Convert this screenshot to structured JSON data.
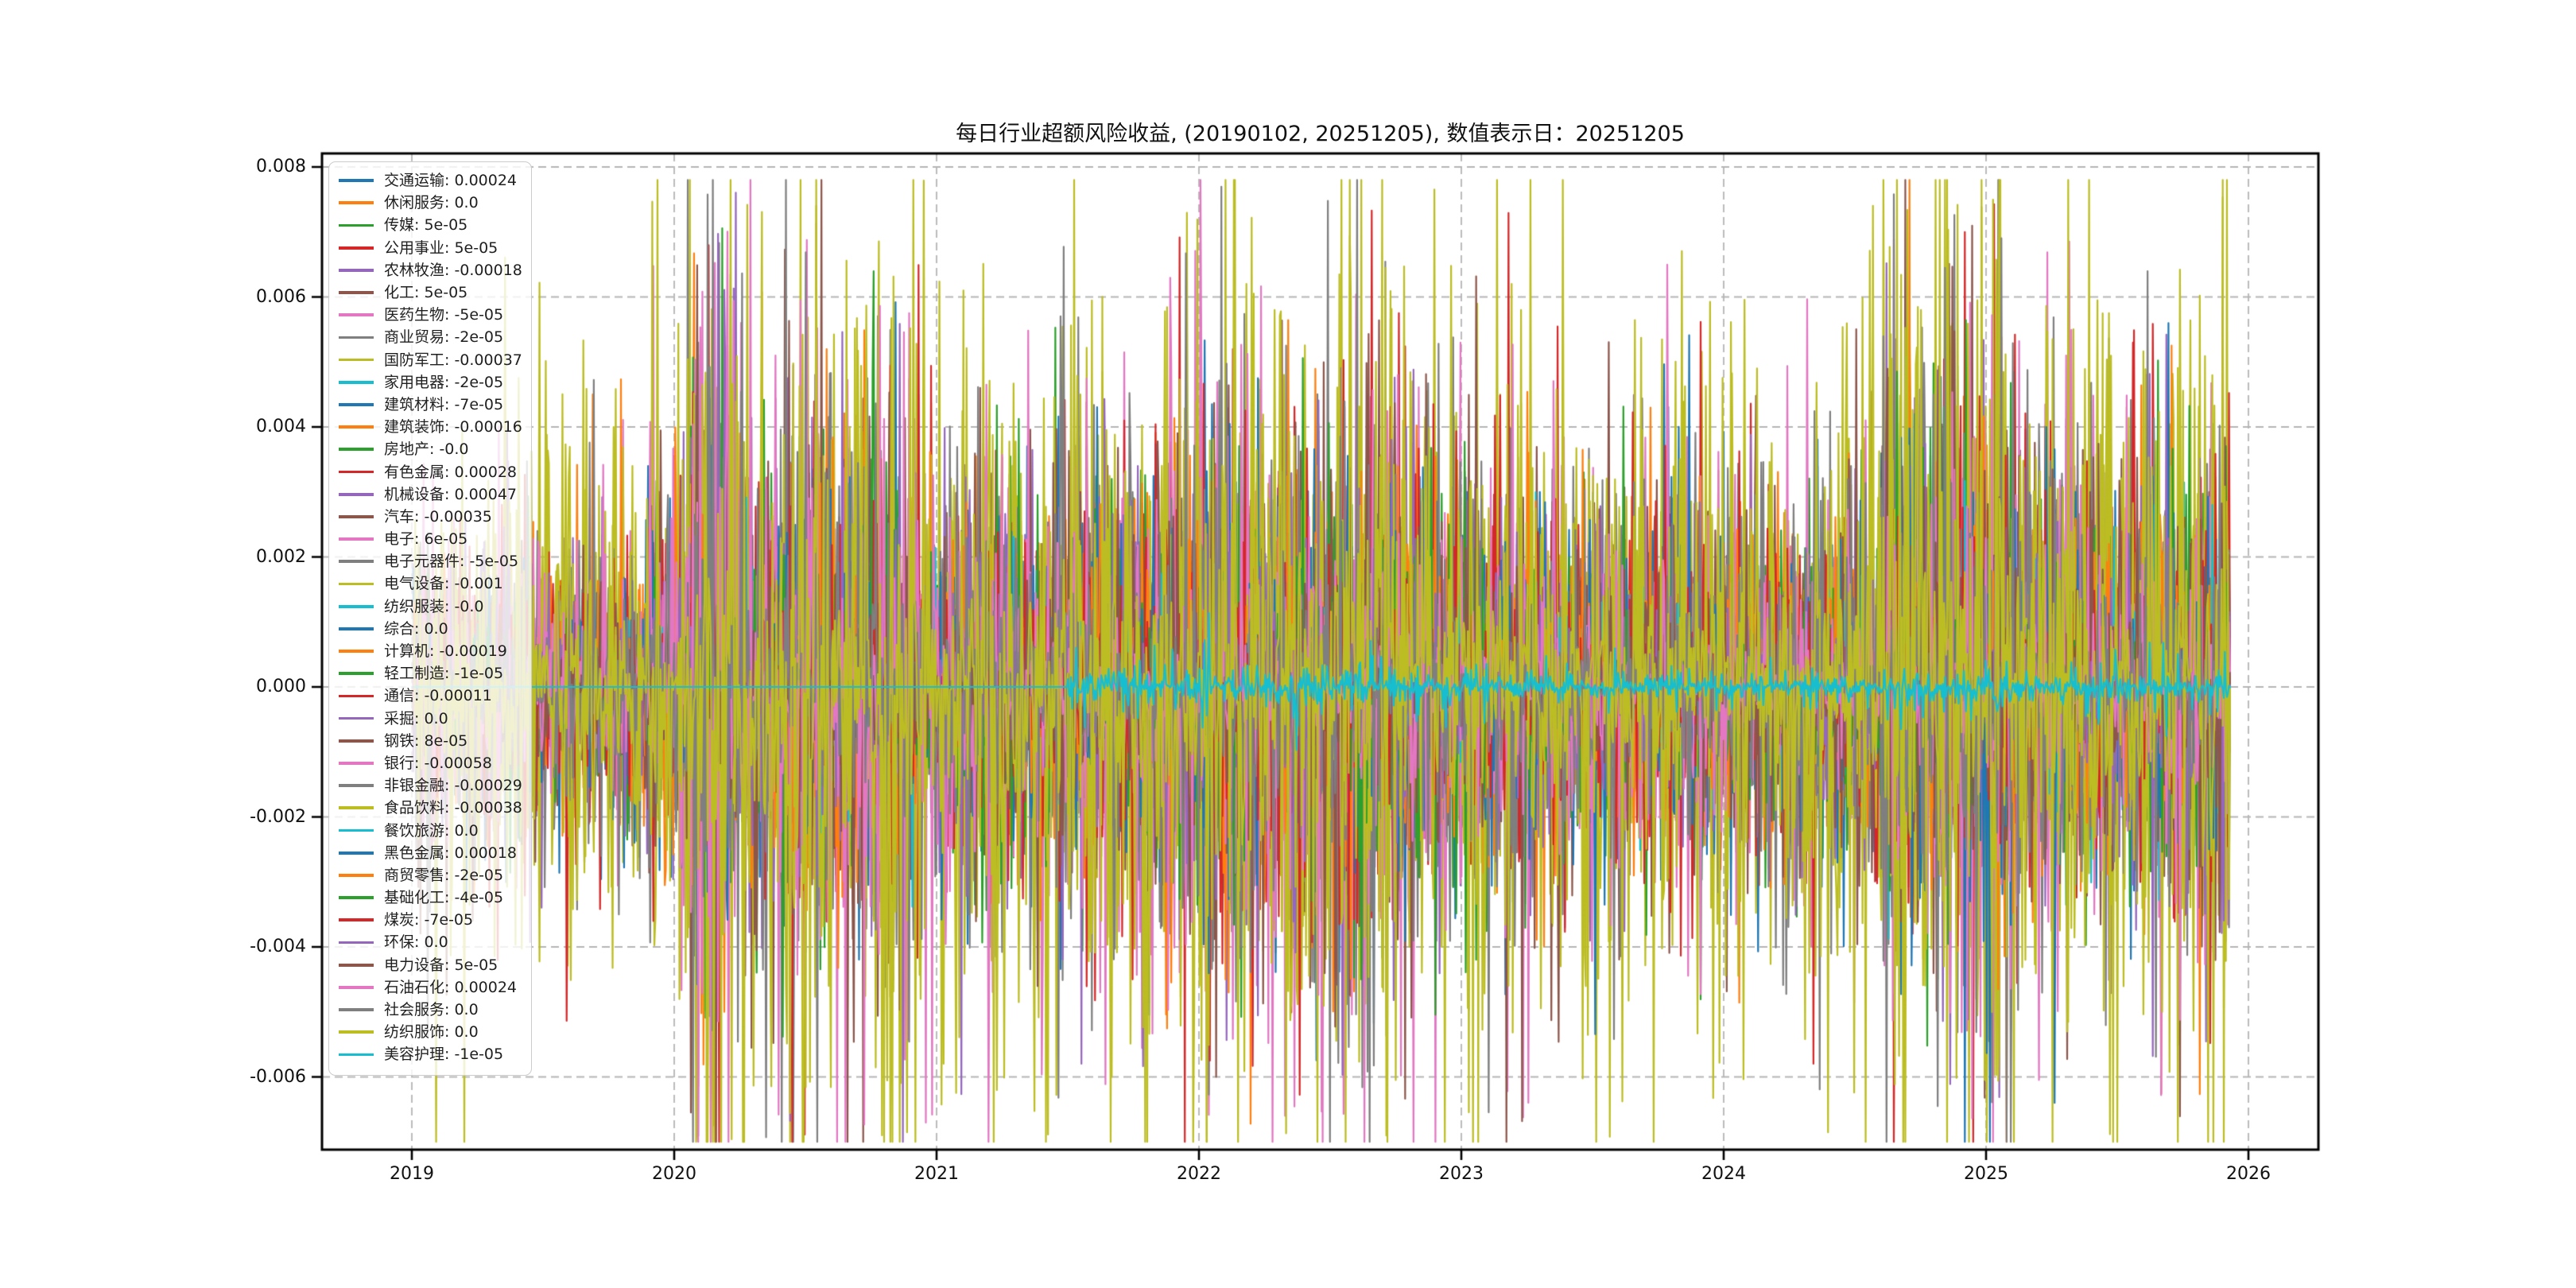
{
  "title": "每日行业超额风险收益, (20190102, 20251205),  数值表示日：20251205",
  "chart_data": {
    "type": "line",
    "title": "每日行业超额风险收益, (20190102, 20251205),  数值表示日：20251205",
    "date_range": {
      "start": "20190102",
      "end": "20251205",
      "value_label_date": "20251205"
    },
    "x_axis": {
      "tick_labels": [
        "2019",
        "2020",
        "2021",
        "2022",
        "2023",
        "2024",
        "2025",
        "2026"
      ],
      "tick_years": [
        2019,
        2020,
        2021,
        2022,
        2023,
        2024,
        2025,
        2026
      ],
      "lim_years": [
        2018.66,
        2026.27
      ]
    },
    "y_axis": {
      "tick_labels": [
        "0.008",
        "0.006",
        "0.004",
        "0.002",
        "0.000",
        "-0.002",
        "-0.004",
        "-0.006"
      ],
      "tick_values": [
        0.008,
        0.006,
        0.004,
        0.002,
        0.0,
        -0.002,
        -0.004,
        -0.006
      ],
      "lim": [
        -0.00712,
        0.00821
      ]
    },
    "grid": {
      "visible": true,
      "style": "dashed",
      "color": "#b5b5b5"
    },
    "legend": {
      "position": "upper left",
      "entries": [
        {
          "name": "交通运输",
          "value": "0.00024",
          "num": 0.00024,
          "color": "#1f77b4"
        },
        {
          "name": "休闲服务",
          "value": "0.0",
          "num": 0.0,
          "color": "#ff7f0e"
        },
        {
          "name": "传媒",
          "value": "5e-05",
          "num": 5e-05,
          "color": "#2ca02c"
        },
        {
          "name": "公用事业",
          "value": "5e-05",
          "num": 5e-05,
          "color": "#d62728"
        },
        {
          "name": "农林牧渔",
          "value": "-0.00018",
          "num": -0.00018,
          "color": "#9467bd"
        },
        {
          "name": "化工",
          "value": "5e-05",
          "num": 5e-05,
          "color": "#8c564b"
        },
        {
          "name": "医药生物",
          "value": "-5e-05",
          "num": -5e-05,
          "color": "#e377c2"
        },
        {
          "name": "商业贸易",
          "value": "-2e-05",
          "num": -2e-05,
          "color": "#7f7f7f"
        },
        {
          "name": "国防军工",
          "value": "-0.00037",
          "num": -0.00037,
          "color": "#bcbd22"
        },
        {
          "name": "家用电器",
          "value": "-2e-05",
          "num": -2e-05,
          "color": "#17becf"
        },
        {
          "name": "建筑材料",
          "value": "-7e-05",
          "num": -7e-05,
          "color": "#1f77b4"
        },
        {
          "name": "建筑装饰",
          "value": "-0.00016",
          "num": -0.00016,
          "color": "#ff7f0e"
        },
        {
          "name": "房地产",
          "value": "-0.0",
          "num": 0.0,
          "color": "#2ca02c"
        },
        {
          "name": "有色金属",
          "value": "0.00028",
          "num": 0.00028,
          "color": "#d62728"
        },
        {
          "name": "机械设备",
          "value": "0.00047",
          "num": 0.00047,
          "color": "#9467bd"
        },
        {
          "name": "汽车",
          "value": "-0.00035",
          "num": -0.00035,
          "color": "#8c564b"
        },
        {
          "name": "电子",
          "value": "6e-05",
          "num": 6e-05,
          "color": "#e377c2"
        },
        {
          "name": "电子元器件",
          "value": "-5e-05",
          "num": -5e-05,
          "color": "#7f7f7f"
        },
        {
          "name": "电气设备",
          "value": "-0.001",
          "num": -0.001,
          "color": "#bcbd22"
        },
        {
          "name": "纺织服装",
          "value": "-0.0",
          "num": 0.0,
          "color": "#17becf"
        },
        {
          "name": "综合",
          "value": "0.0",
          "num": 0.0,
          "color": "#1f77b4"
        },
        {
          "name": "计算机",
          "value": "-0.00019",
          "num": -0.00019,
          "color": "#ff7f0e"
        },
        {
          "name": "轻工制造",
          "value": "-1e-05",
          "num": -1e-05,
          "color": "#2ca02c"
        },
        {
          "name": "通信",
          "value": "-0.00011",
          "num": -0.00011,
          "color": "#d62728"
        },
        {
          "name": "采掘",
          "value": "0.0",
          "num": 0.0,
          "color": "#9467bd"
        },
        {
          "name": "钢铁",
          "value": "8e-05",
          "num": 8e-05,
          "color": "#8c564b"
        },
        {
          "name": "银行",
          "value": "-0.00058",
          "num": -0.00058,
          "color": "#e377c2"
        },
        {
          "name": "非银金融",
          "value": "-0.00029",
          "num": -0.00029,
          "color": "#7f7f7f"
        },
        {
          "name": "食品饮料",
          "value": "-0.00038",
          "num": -0.00038,
          "color": "#bcbd22"
        },
        {
          "name": "餐饮旅游",
          "value": "0.0",
          "num": 0.0,
          "color": "#17becf"
        },
        {
          "name": "黑色金属",
          "value": "0.00018",
          "num": 0.00018,
          "color": "#1f77b4"
        },
        {
          "name": "商贸零售",
          "value": "-2e-05",
          "num": -2e-05,
          "color": "#ff7f0e"
        },
        {
          "name": "基础化工",
          "value": "-4e-05",
          "num": -4e-05,
          "color": "#2ca02c"
        },
        {
          "name": "煤炭",
          "value": "-7e-05",
          "num": -7e-05,
          "color": "#d62728"
        },
        {
          "name": "环保",
          "value": "0.0",
          "num": 0.0,
          "color": "#9467bd"
        },
        {
          "name": "电力设备",
          "value": "5e-05",
          "num": 5e-05,
          "color": "#8c564b"
        },
        {
          "name": "石油石化",
          "value": "0.00024",
          "num": 0.00024,
          "color": "#e377c2"
        },
        {
          "name": "社会服务",
          "value": "0.0",
          "num": 0.0,
          "color": "#7f7f7f"
        },
        {
          "name": "纺织服饰",
          "value": "0.0",
          "num": 0.0,
          "color": "#bcbd22"
        },
        {
          "name": "美容护理",
          "value": "-1e-05",
          "num": -1e-05,
          "color": "#17becf"
        }
      ]
    },
    "features": [
      {
        "index": 21,
        "t": 2019.69,
        "value": 0.0045
      },
      {
        "index": 8,
        "t": 2019.77,
        "value": 0.004
      },
      {
        "index": 0,
        "t": 2019.9,
        "value": 0.0034
      },
      {
        "index": 12,
        "t": 2020.08,
        "value": -0.0034
      },
      {
        "index": 7,
        "t": 2020.09,
        "value": 0.0053
      },
      {
        "index": 28,
        "t": 2020.12,
        "value": 0.0047
      },
      {
        "index": 21,
        "t": 2020.19,
        "value": -0.005
      },
      {
        "index": 28,
        "t": 2020.54,
        "value": 0.0074
      },
      {
        "index": 18,
        "t": 2020.6,
        "value": 0.0038
      },
      {
        "index": 8,
        "t": 2020.67,
        "value": 0.004
      },
      {
        "index": 28,
        "t": 2020.76,
        "value": -0.0036
      },
      {
        "index": 8,
        "t": 2020.94,
        "value": -0.0048
      },
      {
        "index": 7,
        "t": 2020.95,
        "value": 0.0036
      },
      {
        "index": 26,
        "t": 2021.05,
        "value": 0.0026
      },
      {
        "index": 17,
        "t": 2021.2,
        "value": -0.004
      },
      {
        "index": 8,
        "t": 2021.55,
        "value": 0.0045
      },
      {
        "index": 13,
        "t": 2021.55,
        "value": 0.003
      },
      {
        "index": 26,
        "t": 2021.87,
        "value": 0.0035
      },
      {
        "index": 21,
        "t": 2022.1,
        "value": -0.0045
      },
      {
        "index": 18,
        "t": 2022.18,
        "value": 0.0062
      },
      {
        "index": 28,
        "t": 2022.29,
        "value": 0.0058
      },
      {
        "index": 8,
        "t": 2022.4,
        "value": -0.0035
      },
      {
        "index": 18,
        "t": 2022.48,
        "value": -0.004
      },
      {
        "index": 32,
        "t": 2022.62,
        "value": -0.0045
      },
      {
        "index": 26,
        "t": 2022.76,
        "value": 0.0048
      },
      {
        "index": 28,
        "t": 2022.8,
        "value": -0.004
      },
      {
        "index": 7,
        "t": 2022.9,
        "value": 0.003
      },
      {
        "index": 20,
        "t": 2023.3,
        "value": 0.003
      },
      {
        "index": 26,
        "t": 2023.35,
        "value": 0.0029
      },
      {
        "index": 30,
        "t": 2024.73,
        "value": 0.0042
      },
      {
        "index": 38,
        "t": 2024.75,
        "value": 0.0058
      },
      {
        "index": 27,
        "t": 2024.8,
        "value": 0.0045
      },
      {
        "index": 28,
        "t": 2024.84,
        "value": -0.0043
      },
      {
        "index": 18,
        "t": 2024.9,
        "value": -0.0035
      },
      {
        "index": 38,
        "t": 2025.15,
        "value": -0.0042
      },
      {
        "index": 30,
        "t": 2025.23,
        "value": 0.004
      },
      {
        "index": 30,
        "t": 2025.26,
        "value": -0.0064
      },
      {
        "index": 28,
        "t": 2025.67,
        "value": -0.005
      },
      {
        "index": 23,
        "t": 2025.84,
        "value": 0.0024
      }
    ],
    "render": {
      "seed": 20251205,
      "points": 1741,
      "t_start": 2019.005,
      "t_end": 2025.93,
      "late_start_year": 2021.5,
      "late_start_indices": [
        29,
        30,
        31,
        32,
        33,
        34,
        35,
        36,
        37,
        38,
        39
      ],
      "sigmas": [
        0.00038,
        0.00038,
        0.00036,
        0.00038,
        0.0004,
        0.00048,
        0.0005,
        0.00055,
        0.00085,
        0.00022,
        0.00038,
        0.00038,
        0.00036,
        0.0005,
        0.00042,
        0.00048,
        0.00045,
        0.00055,
        0.00085,
        0.00022,
        0.0004,
        0.00042,
        0.00036,
        0.00042,
        0.0004,
        0.00048,
        0.00065,
        0.00055,
        0.00085,
        0.00022,
        0.00045,
        0.00038,
        0.00036,
        0.00042,
        0.00038,
        0.00048,
        0.00045,
        0.0005,
        0.00085,
        7e-05
      ]
    }
  },
  "colors": {
    "background": "#ffffff",
    "spine": "#000000",
    "grid": "#b5b5b5"
  }
}
